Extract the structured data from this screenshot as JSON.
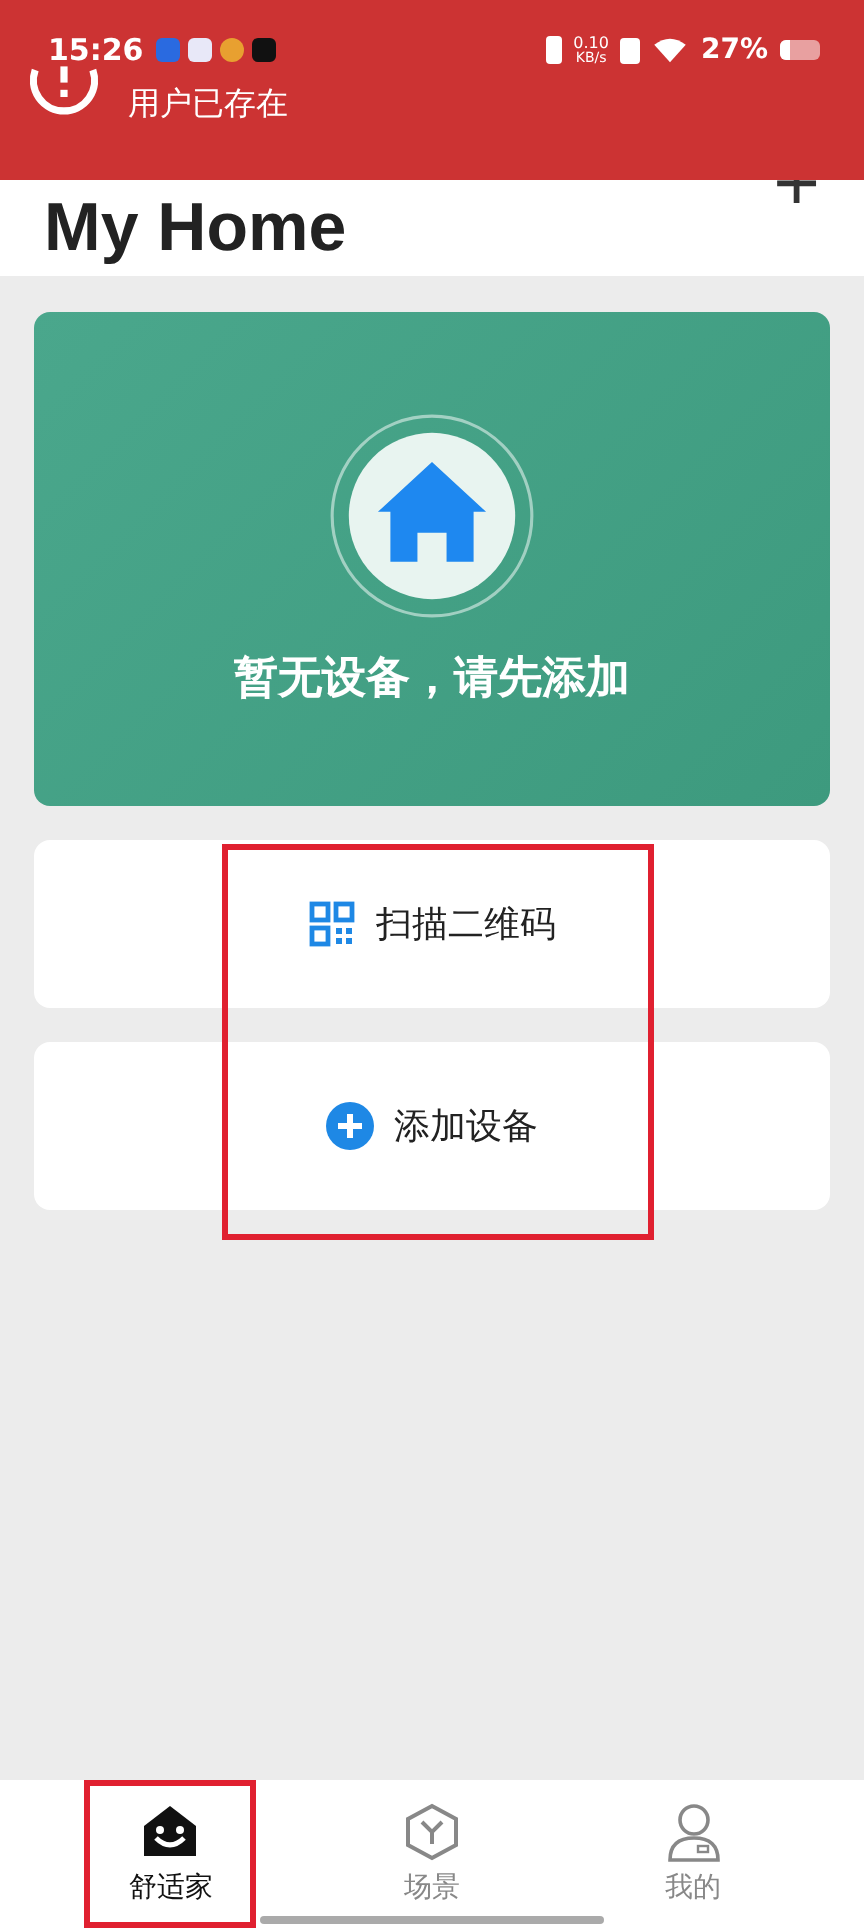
{
  "status_bar": {
    "time": "15:26",
    "net_speed": "0.10",
    "net_unit": "KB/s",
    "battery": "27%"
  },
  "toast": {
    "message": "用户已存在"
  },
  "header": {
    "title": "My Home",
    "add": "+"
  },
  "empty_card": {
    "message": "暂无设备，请先添加"
  },
  "actions": [
    {
      "kind": "scan",
      "label": "扫描二维码"
    },
    {
      "kind": "add",
      "label": "添加设备"
    }
  ],
  "tabs": [
    {
      "kind": "home",
      "label": "舒适家",
      "selected": true
    },
    {
      "kind": "scene",
      "label": "场景",
      "selected": false
    },
    {
      "kind": "me",
      "label": "我的",
      "selected": false
    }
  ]
}
